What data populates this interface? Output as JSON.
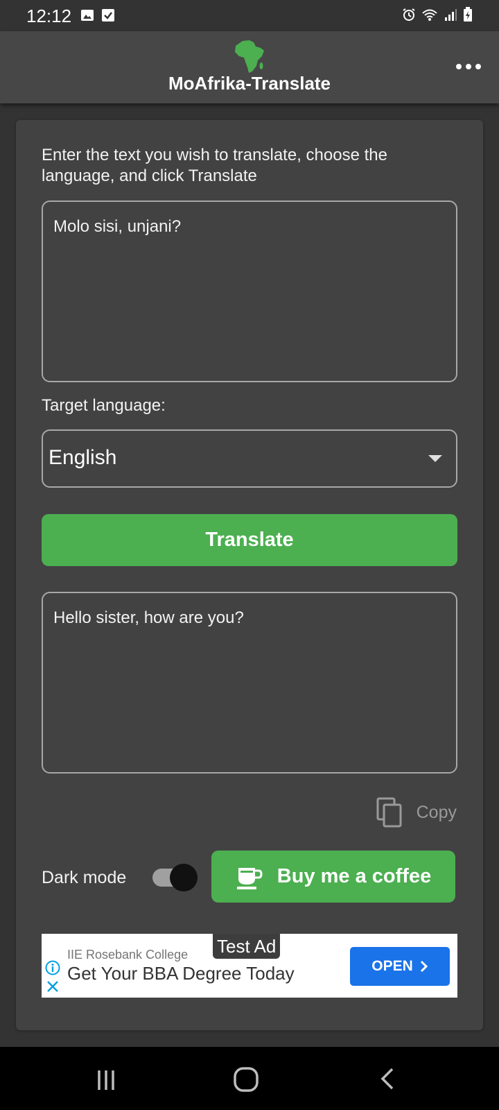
{
  "status_bar": {
    "time": "12:12",
    "left_icons": [
      "gallery-icon",
      "checkbox-icon"
    ],
    "right_icons": [
      "alarm-icon",
      "wifi-icon",
      "signal-icon",
      "battery-charging-icon"
    ]
  },
  "app_bar": {
    "logo": "africa-map-icon",
    "title": "MoAfrika-Translate",
    "menu_icon": "more-horizontal-icon"
  },
  "form": {
    "instructions": "Enter the text you wish to translate, choose the language, and click Translate",
    "source_text": "Molo sisi, unjani?",
    "target_label": "Target language:",
    "target_language": "English",
    "translate_label": "Translate",
    "result_text": "Hello sister, how are you?",
    "copy_label": "Copy",
    "dark_mode_label": "Dark mode",
    "dark_mode_on": true,
    "coffee_label": "Buy me a coffee"
  },
  "ad": {
    "tag": "Test Ad",
    "sponsor": "IIE Rosebank College",
    "headline": "Get Your BBA Degree Today",
    "cta": "OPEN"
  },
  "nav_bar": {
    "buttons": [
      "recent-apps-icon",
      "home-icon",
      "back-icon"
    ]
  },
  "colors": {
    "accent": "#4caf50",
    "background": "#333333",
    "card": "#424242",
    "ad_cta": "#1a73e8"
  }
}
